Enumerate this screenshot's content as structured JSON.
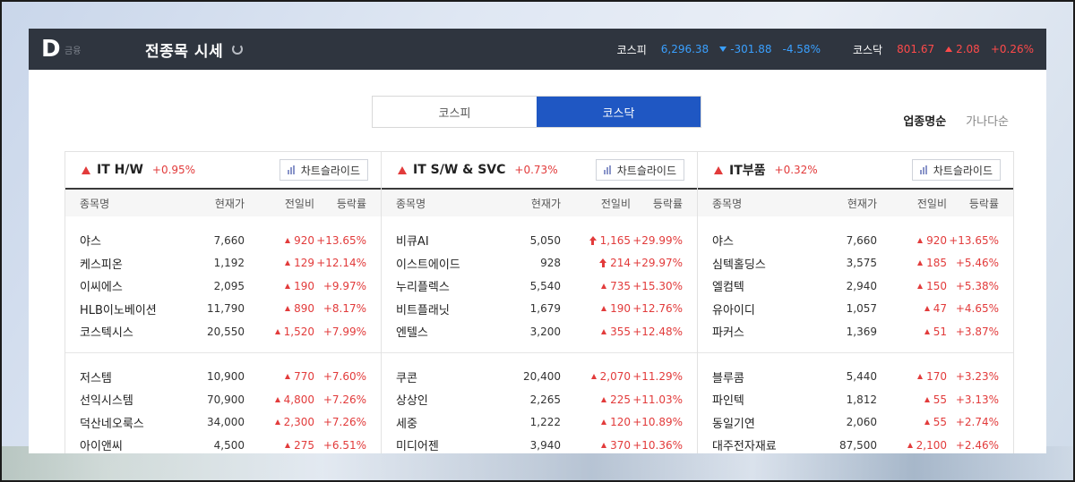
{
  "header": {
    "logo": "D",
    "logo_sub": "금융",
    "title": "전종목 시세",
    "kospi": {
      "name": "코스피",
      "value": "6,296.38",
      "change": "-301.88",
      "pct": "-4.58%"
    },
    "kosdaq": {
      "name": "코스닥",
      "value": "801.67",
      "change": "2.08",
      "pct": "+0.26%"
    }
  },
  "tabs": [
    {
      "label": "코스피"
    },
    {
      "label": "코스닥"
    }
  ],
  "sort": [
    {
      "label": "업종명순"
    },
    {
      "label": "가나다순"
    }
  ],
  "columns": {
    "name": "종목명",
    "price": "현재가",
    "change": "전일비",
    "pct": "등락률"
  },
  "chart_button": "차트슬라이드",
  "colors": {
    "up": "#e23b3b",
    "down": "#3aa0ff",
    "active_tab": "#1f57c3",
    "topbar": "#2f353f"
  },
  "sectors": [
    {
      "name": "IT H/W",
      "rate": "+0.95%",
      "groups": [
        [
          {
            "name": "야스",
            "price": "7,660",
            "change": "920",
            "pct": "+13.65%",
            "mark": "up"
          },
          {
            "name": "케스피온",
            "price": "1,192",
            "change": "129",
            "pct": "+12.14%",
            "mark": "up"
          },
          {
            "name": "이씨에스",
            "price": "2,095",
            "change": "190",
            "pct": "+9.97%",
            "mark": "up"
          },
          {
            "name": "HLB이노베이션",
            "price": "11,790",
            "change": "890",
            "pct": "+8.17%",
            "mark": "up"
          },
          {
            "name": "코스텍시스",
            "price": "20,550",
            "change": "1,520",
            "pct": "+7.99%",
            "mark": "up"
          }
        ],
        [
          {
            "name": "저스템",
            "price": "10,900",
            "change": "770",
            "pct": "+7.60%",
            "mark": "up"
          },
          {
            "name": "선익시스템",
            "price": "70,900",
            "change": "4,800",
            "pct": "+7.26%",
            "mark": "up"
          },
          {
            "name": "덕산네오룩스",
            "price": "34,000",
            "change": "2,300",
            "pct": "+7.26%",
            "mark": "up"
          },
          {
            "name": "아이앤씨",
            "price": "4,500",
            "change": "275",
            "pct": "+6.51%",
            "mark": "up"
          }
        ]
      ]
    },
    {
      "name": "IT S/W & SVC",
      "rate": "+0.73%",
      "groups": [
        [
          {
            "name": "비큐AI",
            "price": "5,050",
            "change": "1,165",
            "pct": "+29.99%",
            "mark": "limit"
          },
          {
            "name": "이스트에이드",
            "price": "928",
            "change": "214",
            "pct": "+29.97%",
            "mark": "limit"
          },
          {
            "name": "누리플렉스",
            "price": "5,540",
            "change": "735",
            "pct": "+15.30%",
            "mark": "up"
          },
          {
            "name": "비트플래닛",
            "price": "1,679",
            "change": "190",
            "pct": "+12.76%",
            "mark": "up"
          },
          {
            "name": "엔텔스",
            "price": "3,200",
            "change": "355",
            "pct": "+12.48%",
            "mark": "up"
          }
        ],
        [
          {
            "name": "쿠콘",
            "price": "20,400",
            "change": "2,070",
            "pct": "+11.29%",
            "mark": "up"
          },
          {
            "name": "상상인",
            "price": "2,265",
            "change": "225",
            "pct": "+11.03%",
            "mark": "up"
          },
          {
            "name": "세중",
            "price": "1,222",
            "change": "120",
            "pct": "+10.89%",
            "mark": "up"
          },
          {
            "name": "미디어젠",
            "price": "3,940",
            "change": "370",
            "pct": "+10.36%",
            "mark": "up"
          }
        ]
      ]
    },
    {
      "name": "IT부품",
      "rate": "+0.32%",
      "groups": [
        [
          {
            "name": "야스",
            "price": "7,660",
            "change": "920",
            "pct": "+13.65%",
            "mark": "up"
          },
          {
            "name": "심텍홀딩스",
            "price": "3,575",
            "change": "185",
            "pct": "+5.46%",
            "mark": "up"
          },
          {
            "name": "엘컴텍",
            "price": "2,940",
            "change": "150",
            "pct": "+5.38%",
            "mark": "up"
          },
          {
            "name": "유아이디",
            "price": "1,057",
            "change": "47",
            "pct": "+4.65%",
            "mark": "up"
          },
          {
            "name": "파커스",
            "price": "1,369",
            "change": "51",
            "pct": "+3.87%",
            "mark": "up"
          }
        ],
        [
          {
            "name": "블루콤",
            "price": "5,440",
            "change": "170",
            "pct": "+3.23%",
            "mark": "up"
          },
          {
            "name": "파인텍",
            "price": "1,812",
            "change": "55",
            "pct": "+3.13%",
            "mark": "up"
          },
          {
            "name": "동일기연",
            "price": "2,060",
            "change": "55",
            "pct": "+2.74%",
            "mark": "up"
          },
          {
            "name": "대주전자재료",
            "price": "87,500",
            "change": "2,100",
            "pct": "+2.46%",
            "mark": "up"
          }
        ]
      ]
    }
  ]
}
